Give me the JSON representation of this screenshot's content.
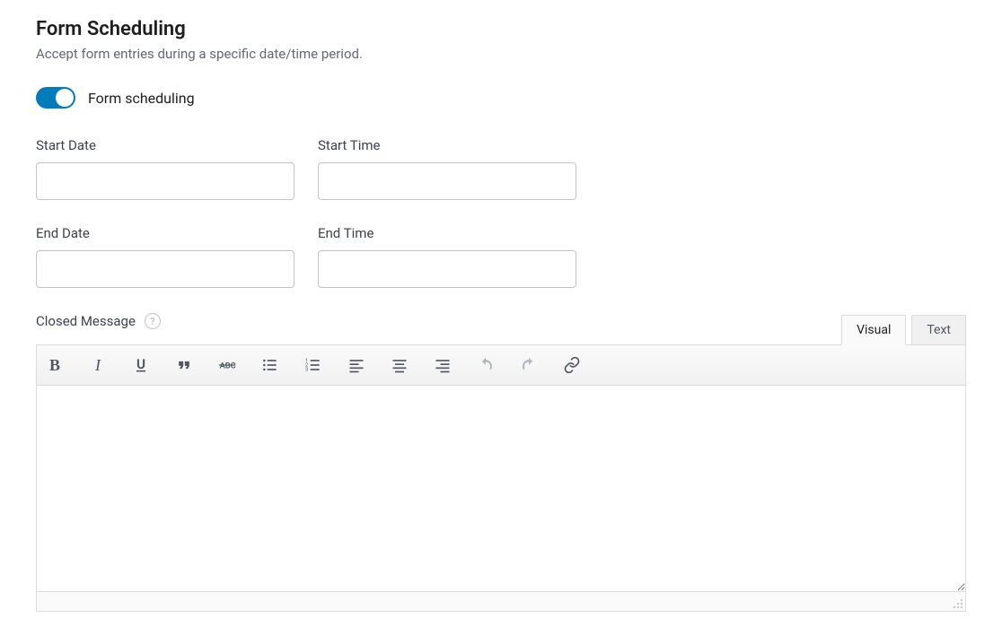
{
  "header": {
    "title": "Form Scheduling",
    "description": "Accept form entries during a specific date/time period."
  },
  "toggle": {
    "label": "Form scheduling",
    "enabled": true
  },
  "fields": {
    "start_date": {
      "label": "Start Date",
      "value": ""
    },
    "start_time": {
      "label": "Start Time",
      "value": ""
    },
    "end_date": {
      "label": "End Date",
      "value": ""
    },
    "end_time": {
      "label": "End Time",
      "value": ""
    }
  },
  "closed_message": {
    "label": "Closed Message"
  },
  "editor": {
    "tabs": {
      "visual": "Visual",
      "text": "Text"
    },
    "content": ""
  }
}
